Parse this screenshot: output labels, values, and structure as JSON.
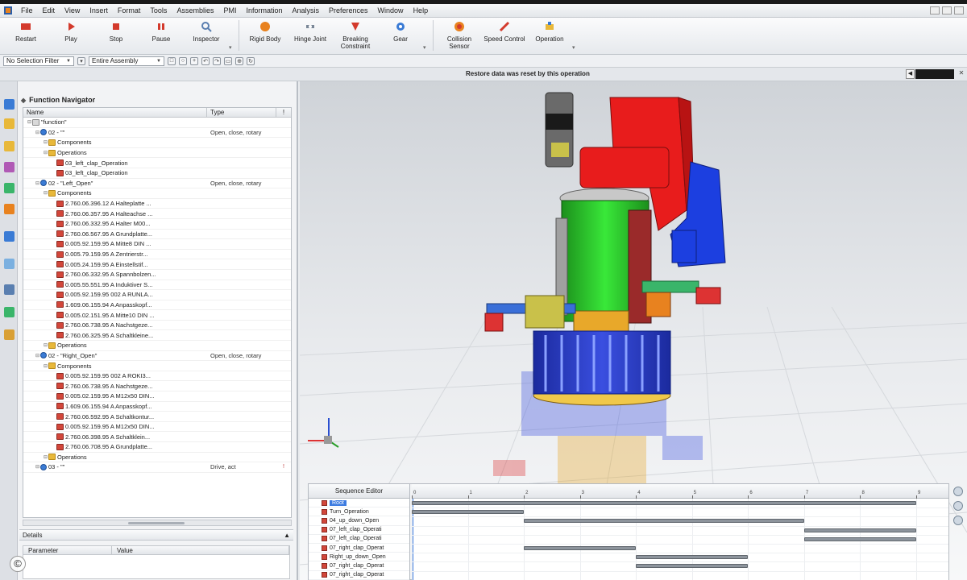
{
  "menu": [
    "File",
    "Edit",
    "View",
    "Insert",
    "Format",
    "Tools",
    "Assemblies",
    "PMI",
    "Information",
    "Analysis",
    "Preferences",
    "Window",
    "Help"
  ],
  "ribbon": {
    "buttons": [
      {
        "label": "Restart",
        "icon": "restart-icon",
        "color": "#d33a2c"
      },
      {
        "label": "Play",
        "icon": "play-icon",
        "color": "#d33a2c"
      },
      {
        "label": "Stop",
        "icon": "stop-icon",
        "color": "#d33a2c"
      },
      {
        "label": "Pause",
        "icon": "pause-icon",
        "color": "#d33a2c"
      },
      {
        "label": "Inspector",
        "icon": "inspector-icon",
        "color": "#5a7fb0"
      },
      {
        "label": "Rigid Body",
        "icon": "rigid-body-icon",
        "color": "#e8821f"
      },
      {
        "label": "Hinge Joint",
        "icon": "hinge-joint-icon",
        "color": "#7a8797"
      },
      {
        "label": "Breaking Constraint",
        "icon": "breaking-constraint-icon",
        "color": "#d33a2c"
      },
      {
        "label": "Gear",
        "icon": "gear-icon",
        "color": "#3a7bd5"
      },
      {
        "label": "Collision Sensor",
        "icon": "collision-sensor-icon",
        "color": "#e8821f"
      },
      {
        "label": "Speed Control",
        "icon": "speed-control-icon",
        "color": "#d33a2c"
      },
      {
        "label": "Operation",
        "icon": "operation-icon",
        "color": "#e8b83a"
      }
    ]
  },
  "selection": {
    "filter": "No Selection Filter",
    "scope": "Entire Assembly"
  },
  "status": {
    "message": "Restore data was reset by this operation"
  },
  "navigator": {
    "title": "Function Navigator",
    "columns": [
      "Name",
      "Type",
      "!"
    ],
    "rows": [
      {
        "depth": 0,
        "icon": "root",
        "name": "\"function\"",
        "type": ""
      },
      {
        "depth": 1,
        "icon": "op",
        "name": "02 - \"\"",
        "type": "Open, close, rotary"
      },
      {
        "depth": 2,
        "icon": "folder",
        "name": "Components",
        "type": ""
      },
      {
        "depth": 2,
        "icon": "folder",
        "name": "Operations",
        "type": ""
      },
      {
        "depth": 3,
        "icon": "part",
        "name": "03_left_clap_Operation",
        "type": ""
      },
      {
        "depth": 3,
        "icon": "part",
        "name": "03_left_clap_Operation",
        "type": ""
      },
      {
        "depth": 1,
        "icon": "op",
        "name": "02 - \"Left_Open\"",
        "type": "Open, close, rotary"
      },
      {
        "depth": 2,
        "icon": "folder",
        "name": "Components",
        "type": ""
      },
      {
        "depth": 3,
        "icon": "part",
        "name": "2.760.06.396.12 A Halteplatte ...",
        "type": ""
      },
      {
        "depth": 3,
        "icon": "part",
        "name": "2.760.06.357.95 A Halteachse ...",
        "type": ""
      },
      {
        "depth": 3,
        "icon": "part",
        "name": "2.760.06.332.95 A Halter M00...",
        "type": ""
      },
      {
        "depth": 3,
        "icon": "part",
        "name": "2.760.06.567.95 A Grundplatte...",
        "type": ""
      },
      {
        "depth": 3,
        "icon": "part",
        "name": "0.005.92.159.95 A Mitte8 DIN ...",
        "type": ""
      },
      {
        "depth": 3,
        "icon": "part",
        "name": "0.005.79.159.95 A Zentrierstr...",
        "type": ""
      },
      {
        "depth": 3,
        "icon": "part",
        "name": "0.005.24.159.95 A Einstellstif...",
        "type": ""
      },
      {
        "depth": 3,
        "icon": "part",
        "name": "2.760.06.332.95 A Spannbolzen...",
        "type": ""
      },
      {
        "depth": 3,
        "icon": "part",
        "name": "0.005.55.551.95 A Induktiver S...",
        "type": ""
      },
      {
        "depth": 3,
        "icon": "part",
        "name": "0.005.92.159.95 002 A RUNLA...",
        "type": ""
      },
      {
        "depth": 3,
        "icon": "part",
        "name": "1.609.06.155.94 A Anpasskopf...",
        "type": ""
      },
      {
        "depth": 3,
        "icon": "part",
        "name": "0.005.02.151.95 A Mitte10 DIN ...",
        "type": ""
      },
      {
        "depth": 3,
        "icon": "part",
        "name": "2.760.06.738.95 A Nachstgeze...",
        "type": ""
      },
      {
        "depth": 3,
        "icon": "part",
        "name": "2.760.06.325.95 A Schaltkleine...",
        "type": ""
      },
      {
        "depth": 2,
        "icon": "folder",
        "name": "Operations",
        "type": ""
      },
      {
        "depth": 1,
        "icon": "op",
        "name": "02 - \"Right_Open\"",
        "type": "Open, close, rotary"
      },
      {
        "depth": 2,
        "icon": "folder",
        "name": "Components",
        "type": ""
      },
      {
        "depth": 3,
        "icon": "part",
        "name": "0.005.92.159.95 002 A ROKI3...",
        "type": ""
      },
      {
        "depth": 3,
        "icon": "part",
        "name": "2.760.06.738.95 A Nachstgeze...",
        "type": ""
      },
      {
        "depth": 3,
        "icon": "part",
        "name": "0.005.02.159.95 A M12x50 DIN...",
        "type": ""
      },
      {
        "depth": 3,
        "icon": "part",
        "name": "1.609.06.155.94 A Anpasskopf...",
        "type": ""
      },
      {
        "depth": 3,
        "icon": "part",
        "name": "2.760.06.592.95 A Schaltkontur...",
        "type": ""
      },
      {
        "depth": 3,
        "icon": "part",
        "name": "0.005.92.159.95 A M12x50 DIN...",
        "type": ""
      },
      {
        "depth": 3,
        "icon": "part",
        "name": "2.760.06.398.95 A Schaltklein...",
        "type": ""
      },
      {
        "depth": 3,
        "icon": "part",
        "name": "2.760.06.708.95 A Grundplatte...",
        "type": ""
      },
      {
        "depth": 2,
        "icon": "folder",
        "name": "Operations",
        "type": ""
      },
      {
        "depth": 1,
        "icon": "op",
        "name": "03 - \"\"",
        "type": "Drive, act",
        "flag": "!"
      }
    ]
  },
  "details": {
    "title": "Details",
    "columns": [
      "Parameter",
      "Value"
    ]
  },
  "sequence": {
    "title": "Sequence Editor",
    "rows": [
      {
        "label": "Root",
        "selected": true
      },
      {
        "label": "Turn_Operation",
        "selected": false
      },
      {
        "label": "04_up_down_Open",
        "selected": false
      },
      {
        "label": "07_left_clap_Operati",
        "selected": false
      },
      {
        "label": "07_left_clap_Operati",
        "selected": false
      },
      {
        "label": "07_right_clap_Operat",
        "selected": false
      },
      {
        "label": "Right_up_down_Open",
        "selected": false
      },
      {
        "label": "07_right_clap_Operat",
        "selected": false
      },
      {
        "label": "07_right_clap_Operat",
        "selected": false
      }
    ],
    "ticks": [
      "0",
      "1",
      "2",
      "3",
      "4",
      "5",
      "6",
      "7",
      "8",
      "9"
    ],
    "bars": [
      {
        "row": 0,
        "start": 0,
        "end": 9
      },
      {
        "row": 1,
        "start": 0,
        "end": 2
      },
      {
        "row": 2,
        "start": 2,
        "end": 7
      },
      {
        "row": 3,
        "start": 7,
        "end": 9
      },
      {
        "row": 4,
        "start": 7,
        "end": 9
      },
      {
        "row": 5,
        "start": 2,
        "end": 4
      },
      {
        "row": 6,
        "start": 4,
        "end": 6
      },
      {
        "row": 7,
        "start": 4,
        "end": 6
      }
    ]
  },
  "copyright": "©"
}
